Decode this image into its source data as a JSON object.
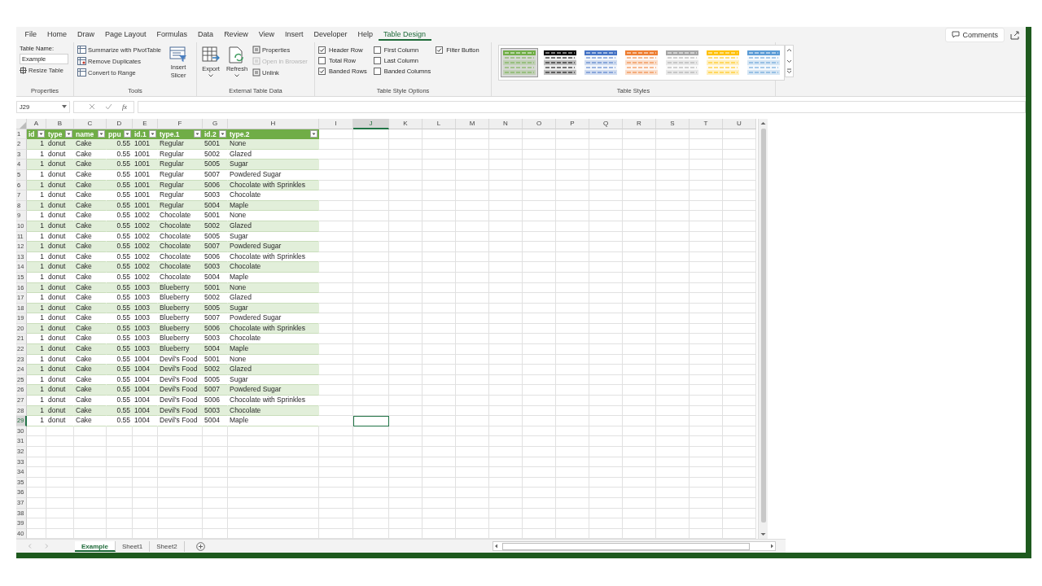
{
  "ribbon_tabs": [
    {
      "label": "File",
      "selected": false
    },
    {
      "label": "Home",
      "selected": false
    },
    {
      "label": "Draw",
      "selected": false
    },
    {
      "label": "Page Layout",
      "selected": false
    },
    {
      "label": "Formulas",
      "selected": false
    },
    {
      "label": "Data",
      "selected": false
    },
    {
      "label": "Review",
      "selected": false
    },
    {
      "label": "View",
      "selected": false
    },
    {
      "label": "Insert",
      "selected": false
    },
    {
      "label": "Developer",
      "selected": false
    },
    {
      "label": "Help",
      "selected": false
    },
    {
      "label": "Table Design",
      "selected": true
    }
  ],
  "comments_button": "Comments",
  "properties_group": {
    "label": "Properties",
    "name_label": "Table Name:",
    "name_value": "Example",
    "resize": "Resize Table"
  },
  "tools_group": {
    "label": "Tools",
    "items": [
      "Summarize with PivotTable",
      "Remove Duplicates",
      "Convert to Range"
    ],
    "slicer": "Insert Slicer"
  },
  "external_group": {
    "label": "External Table Data",
    "export": "Export",
    "refresh": "Refresh",
    "items": [
      {
        "label": "Properties",
        "disabled": false
      },
      {
        "label": "Open in Browser",
        "disabled": true
      },
      {
        "label": "Unlink",
        "disabled": false
      }
    ]
  },
  "style_options_group": {
    "label": "Table Style Options",
    "options": [
      {
        "label": "Header Row",
        "checked": true
      },
      {
        "label": "Total Row",
        "checked": false
      },
      {
        "label": "Banded Rows",
        "checked": true
      },
      {
        "label": "First Column",
        "checked": false
      },
      {
        "label": "Last Column",
        "checked": false
      },
      {
        "label": "Banded Columns",
        "checked": false
      },
      {
        "label": "Filter Button",
        "checked": true
      }
    ]
  },
  "table_styles_group": {
    "label": "Table Styles",
    "swatches": [
      {
        "color": "#70ad47",
        "selected": true
      },
      {
        "color": "#000000",
        "selected": false
      },
      {
        "color": "#4472c4",
        "selected": false
      },
      {
        "color": "#ed7d31",
        "selected": false
      },
      {
        "color": "#a5a5a5",
        "selected": false
      },
      {
        "color": "#ffc000",
        "selected": false
      },
      {
        "color": "#5b9bd5",
        "selected": false
      }
    ]
  },
  "formula_bar": {
    "name_box": "J29",
    "function_label": "fx"
  },
  "grid": {
    "columns": [
      {
        "letter": "A",
        "selected": false
      },
      {
        "letter": "B",
        "selected": false
      },
      {
        "letter": "C",
        "selected": false
      },
      {
        "letter": "D",
        "selected": false
      },
      {
        "letter": "E",
        "selected": false
      },
      {
        "letter": "F",
        "selected": false
      },
      {
        "letter": "G",
        "selected": false
      },
      {
        "letter": "H",
        "selected": false
      },
      {
        "letter": "I",
        "selected": false
      },
      {
        "letter": "J",
        "selected": true
      },
      {
        "letter": "K",
        "selected": false
      },
      {
        "letter": "L",
        "selected": false
      },
      {
        "letter": "M",
        "selected": false
      },
      {
        "letter": "N",
        "selected": false
      },
      {
        "letter": "O",
        "selected": false
      },
      {
        "letter": "P",
        "selected": false
      },
      {
        "letter": "Q",
        "selected": false
      },
      {
        "letter": "R",
        "selected": false
      },
      {
        "letter": "S",
        "selected": false
      },
      {
        "letter": "T",
        "selected": false
      },
      {
        "letter": "U",
        "selected": false
      }
    ],
    "header_row_number": "1",
    "empty_rows": [
      {
        "label": "30",
        "selected": false
      },
      {
        "label": "31",
        "selected": false
      },
      {
        "label": "32",
        "selected": false
      },
      {
        "label": "33",
        "selected": false
      },
      {
        "label": "34",
        "selected": false
      },
      {
        "label": "35",
        "selected": false
      },
      {
        "label": "36",
        "selected": false
      },
      {
        "label": "37",
        "selected": false
      },
      {
        "label": "38",
        "selected": false
      },
      {
        "label": "39",
        "selected": false
      },
      {
        "label": "40",
        "selected": false
      }
    ]
  },
  "table": {
    "columns": [
      {
        "header": "id",
        "kind": "number"
      },
      {
        "header": "type",
        "kind": "text"
      },
      {
        "header": "name",
        "kind": "text"
      },
      {
        "header": "ppu",
        "kind": "number"
      },
      {
        "header": "id.1",
        "kind": "text"
      },
      {
        "header": "type.1",
        "kind": "text"
      },
      {
        "header": "id.2",
        "kind": "text"
      },
      {
        "header": "type.2",
        "kind": "text"
      }
    ],
    "rows": [
      {
        "row_number": "2",
        "selected": false,
        "cells": [
          "1",
          "donut",
          "Cake",
          "0.55",
          "1001",
          "Regular",
          "5001",
          "None"
        ]
      },
      {
        "row_number": "3",
        "selected": false,
        "cells": [
          "1",
          "donut",
          "Cake",
          "0.55",
          "1001",
          "Regular",
          "5002",
          "Glazed"
        ]
      },
      {
        "row_number": "4",
        "selected": false,
        "cells": [
          "1",
          "donut",
          "Cake",
          "0.55",
          "1001",
          "Regular",
          "5005",
          "Sugar"
        ]
      },
      {
        "row_number": "5",
        "selected": false,
        "cells": [
          "1",
          "donut",
          "Cake",
          "0.55",
          "1001",
          "Regular",
          "5007",
          "Powdered Sugar"
        ]
      },
      {
        "row_number": "6",
        "selected": false,
        "cells": [
          "1",
          "donut",
          "Cake",
          "0.55",
          "1001",
          "Regular",
          "5006",
          "Chocolate with Sprinkles"
        ]
      },
      {
        "row_number": "7",
        "selected": false,
        "cells": [
          "1",
          "donut",
          "Cake",
          "0.55",
          "1001",
          "Regular",
          "5003",
          "Chocolate"
        ]
      },
      {
        "row_number": "8",
        "selected": false,
        "cells": [
          "1",
          "donut",
          "Cake",
          "0.55",
          "1001",
          "Regular",
          "5004",
          "Maple"
        ]
      },
      {
        "row_number": "9",
        "selected": false,
        "cells": [
          "1",
          "donut",
          "Cake",
          "0.55",
          "1002",
          "Chocolate",
          "5001",
          "None"
        ]
      },
      {
        "row_number": "10",
        "selected": false,
        "cells": [
          "1",
          "donut",
          "Cake",
          "0.55",
          "1002",
          "Chocolate",
          "5002",
          "Glazed"
        ]
      },
      {
        "row_number": "11",
        "selected": false,
        "cells": [
          "1",
          "donut",
          "Cake",
          "0.55",
          "1002",
          "Chocolate",
          "5005",
          "Sugar"
        ]
      },
      {
        "row_number": "12",
        "selected": false,
        "cells": [
          "1",
          "donut",
          "Cake",
          "0.55",
          "1002",
          "Chocolate",
          "5007",
          "Powdered Sugar"
        ]
      },
      {
        "row_number": "13",
        "selected": false,
        "cells": [
          "1",
          "donut",
          "Cake",
          "0.55",
          "1002",
          "Chocolate",
          "5006",
          "Chocolate with Sprinkles"
        ]
      },
      {
        "row_number": "14",
        "selected": false,
        "cells": [
          "1",
          "donut",
          "Cake",
          "0.55",
          "1002",
          "Chocolate",
          "5003",
          "Chocolate"
        ]
      },
      {
        "row_number": "15",
        "selected": false,
        "cells": [
          "1",
          "donut",
          "Cake",
          "0.55",
          "1002",
          "Chocolate",
          "5004",
          "Maple"
        ]
      },
      {
        "row_number": "16",
        "selected": false,
        "cells": [
          "1",
          "donut",
          "Cake",
          "0.55",
          "1003",
          "Blueberry",
          "5001",
          "None"
        ]
      },
      {
        "row_number": "17",
        "selected": false,
        "cells": [
          "1",
          "donut",
          "Cake",
          "0.55",
          "1003",
          "Blueberry",
          "5002",
          "Glazed"
        ]
      },
      {
        "row_number": "18",
        "selected": false,
        "cells": [
          "1",
          "donut",
          "Cake",
          "0.55",
          "1003",
          "Blueberry",
          "5005",
          "Sugar"
        ]
      },
      {
        "row_number": "19",
        "selected": false,
        "cells": [
          "1",
          "donut",
          "Cake",
          "0.55",
          "1003",
          "Blueberry",
          "5007",
          "Powdered Sugar"
        ]
      },
      {
        "row_number": "20",
        "selected": false,
        "cells": [
          "1",
          "donut",
          "Cake",
          "0.55",
          "1003",
          "Blueberry",
          "5006",
          "Chocolate with Sprinkles"
        ]
      },
      {
        "row_number": "21",
        "selected": false,
        "cells": [
          "1",
          "donut",
          "Cake",
          "0.55",
          "1003",
          "Blueberry",
          "5003",
          "Chocolate"
        ]
      },
      {
        "row_number": "22",
        "selected": false,
        "cells": [
          "1",
          "donut",
          "Cake",
          "0.55",
          "1003",
          "Blueberry",
          "5004",
          "Maple"
        ]
      },
      {
        "row_number": "23",
        "selected": false,
        "cells": [
          "1",
          "donut",
          "Cake",
          "0.55",
          "1004",
          "Devil's Food",
          "5001",
          "None"
        ]
      },
      {
        "row_number": "24",
        "selected": false,
        "cells": [
          "1",
          "donut",
          "Cake",
          "0.55",
          "1004",
          "Devil's Food",
          "5002",
          "Glazed"
        ]
      },
      {
        "row_number": "25",
        "selected": false,
        "cells": [
          "1",
          "donut",
          "Cake",
          "0.55",
          "1004",
          "Devil's Food",
          "5005",
          "Sugar"
        ]
      },
      {
        "row_number": "26",
        "selected": false,
        "cells": [
          "1",
          "donut",
          "Cake",
          "0.55",
          "1004",
          "Devil's Food",
          "5007",
          "Powdered Sugar"
        ]
      },
      {
        "row_number": "27",
        "selected": false,
        "cells": [
          "1",
          "donut",
          "Cake",
          "0.55",
          "1004",
          "Devil's Food",
          "5006",
          "Chocolate with Sprinkles"
        ]
      },
      {
        "row_number": "28",
        "selected": false,
        "cells": [
          "1",
          "donut",
          "Cake",
          "0.55",
          "1004",
          "Devil's Food",
          "5003",
          "Chocolate"
        ]
      },
      {
        "row_number": "29",
        "selected": true,
        "cells": [
          "1",
          "donut",
          "Cake",
          "0.55",
          "1004",
          "Devil's Food",
          "5004",
          "Maple"
        ]
      }
    ]
  },
  "sheet_tabs": [
    {
      "label": "Example",
      "selected": true
    },
    {
      "label": "Sheet1",
      "selected": false
    },
    {
      "label": "Sheet2",
      "selected": false
    }
  ]
}
